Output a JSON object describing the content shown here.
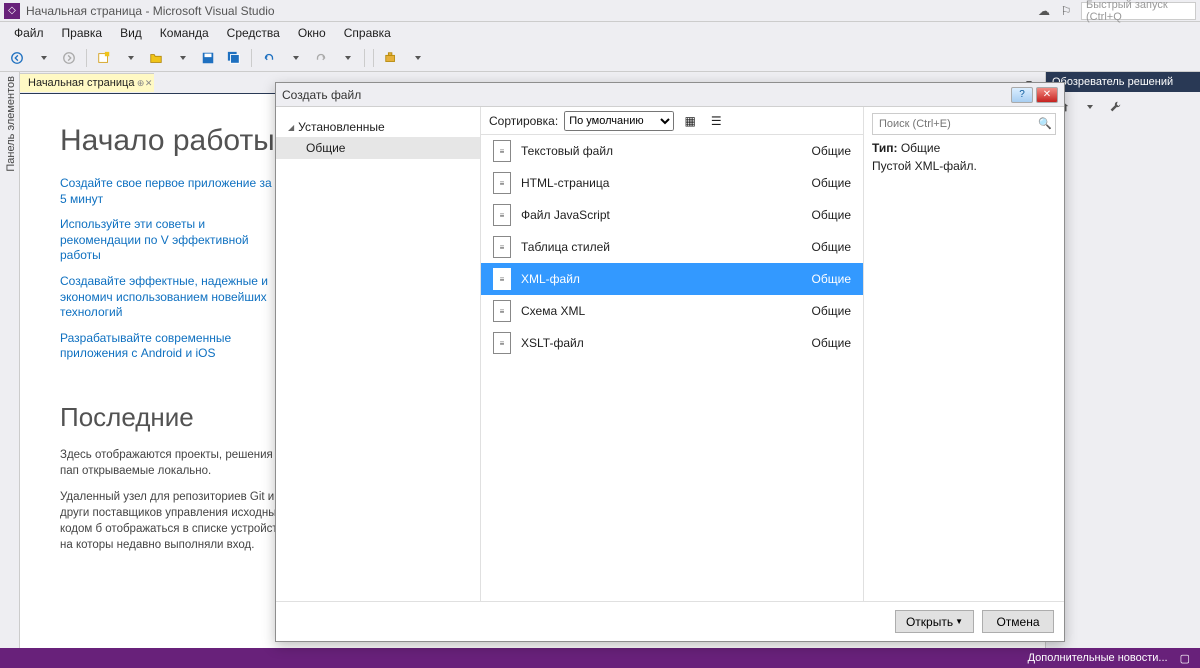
{
  "titlebar": {
    "title": "Начальная страница - Microsoft Visual Studio",
    "quick_launch_placeholder": "Быстрый запуск (Ctrl+Q"
  },
  "menu": [
    "Файл",
    "Правка",
    "Вид",
    "Команда",
    "Средства",
    "Окно",
    "Справка"
  ],
  "doc_tab": {
    "title": "Начальная страница"
  },
  "side_dock_left": "Панель элементов",
  "solution_explorer": {
    "title": "Обозреватель решений"
  },
  "start_page": {
    "heading_get_started": "Начало работы",
    "links": [
      "Создайте свое первое приложение за 5 минут",
      "Используйте эти советы и рекомендации по V эффективной работы",
      "Создавайте эффектные, надежные и экономич использованием новейших технологий",
      "Разрабатывайте современные приложения с Android и iOS"
    ],
    "heading_recent": "Последние",
    "recent_text1": "Здесь отображаются проекты, решения и пап открываемые локально.",
    "recent_text2": "Удаленный узел для репозиториев Git и други поставщиков управления исходным кодом б отображаться в списке устройств, на которы недавно выполняли вход."
  },
  "dialog": {
    "title": "Создать файл",
    "left": {
      "root": "Установленные",
      "child": "Общие"
    },
    "sort": {
      "label": "Сортировка:",
      "value": "По умолчанию"
    },
    "items": [
      {
        "name": "Текстовый файл",
        "cat": "Общие",
        "icon": "txt"
      },
      {
        "name": "HTML-страница",
        "cat": "Общие",
        "icon": "html"
      },
      {
        "name": "Файл JavaScript",
        "cat": "Общие",
        "icon": "js"
      },
      {
        "name": "Таблица стилей",
        "cat": "Общие",
        "icon": "css"
      },
      {
        "name": "XML-файл",
        "cat": "Общие",
        "icon": "xml",
        "selected": true
      },
      {
        "name": "Схема XML",
        "cat": "Общие",
        "icon": "xsd"
      },
      {
        "name": "XSLT-файл",
        "cat": "Общие",
        "icon": "xsl"
      }
    ],
    "search_placeholder": "Поиск (Ctrl+E)",
    "info": {
      "type_label": "Тип:",
      "type_value": "Общие",
      "desc": "Пустой XML-файл."
    },
    "buttons": {
      "open": "Открыть",
      "cancel": "Отмена"
    }
  },
  "statusbar": {
    "news": "Дополнительные новости..."
  }
}
